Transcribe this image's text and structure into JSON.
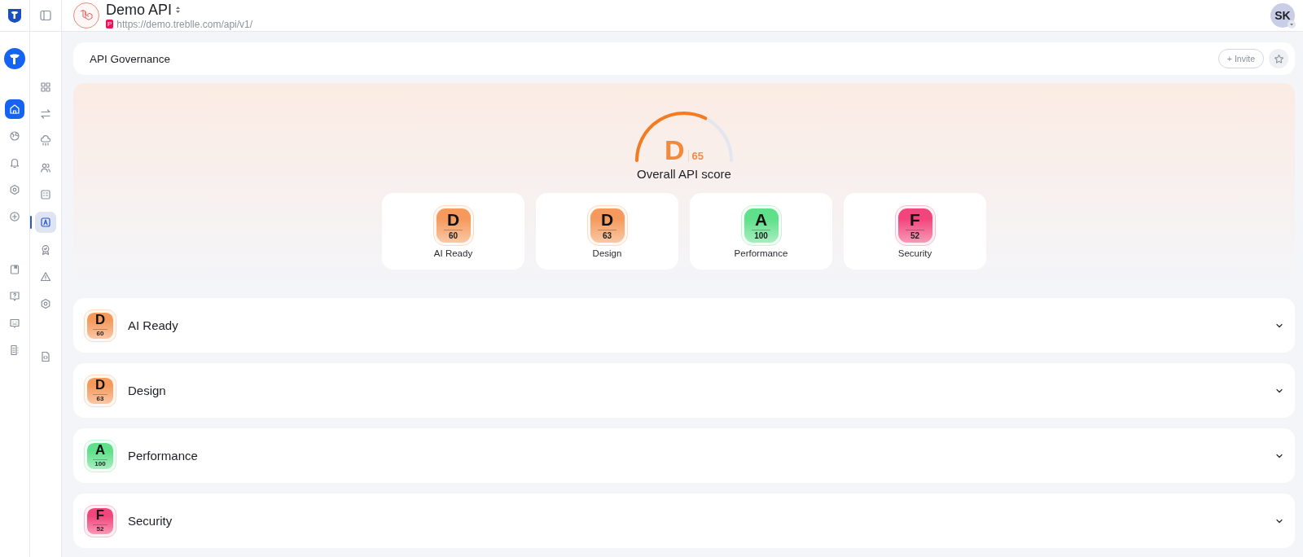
{
  "header": {
    "project": "Demo API",
    "project_badge": "P",
    "url": "https://demo.treblle.com/api/v1/",
    "avatar": "SK"
  },
  "rail": [
    {
      "selected": true
    },
    {
      "selected": false
    },
    {
      "selected": false
    },
    {
      "selected": false
    },
    {
      "selected": false
    },
    {
      "selected": false
    },
    {
      "selected": false
    },
    {
      "selected": false
    },
    {
      "selected": false
    }
  ],
  "subnav": [
    {
      "selected": false
    },
    {
      "selected": false
    },
    {
      "selected": false
    },
    {
      "selected": false
    },
    {
      "selected": false
    },
    {
      "selected": true
    },
    {
      "selected": false
    },
    {
      "selected": false
    },
    {
      "selected": false
    },
    {
      "selected": false
    }
  ],
  "page": {
    "title": "API Governance",
    "invite": "+ Invite"
  },
  "overall": {
    "grade": "D",
    "score": "65",
    "label": "Overall API score",
    "level": 0.65
  },
  "categories": [
    {
      "name": "AI Ready",
      "grade": "D",
      "score": "60",
      "color": "#f59a5c"
    },
    {
      "name": "Design",
      "grade": "D",
      "score": "63",
      "color": "#f59a5c"
    },
    {
      "name": "Performance",
      "grade": "A",
      "score": "100",
      "color": "#5fe08a"
    },
    {
      "name": "Security",
      "grade": "F",
      "score": "52",
      "color": "#f2457c"
    }
  ],
  "sections": [
    {
      "name": "AI Ready",
      "grade": "D",
      "score": "60",
      "color": "#f59a5c",
      "expanded": false
    },
    {
      "name": "Design",
      "grade": "D",
      "score": "63",
      "color": "#f59a5c",
      "expanded": false
    },
    {
      "name": "Performance",
      "grade": "A",
      "score": "100",
      "color": "#5fe08a",
      "expanded": false
    },
    {
      "name": "Security",
      "grade": "F",
      "score": "52",
      "color": "#f2457c",
      "expanded": false
    }
  ]
}
